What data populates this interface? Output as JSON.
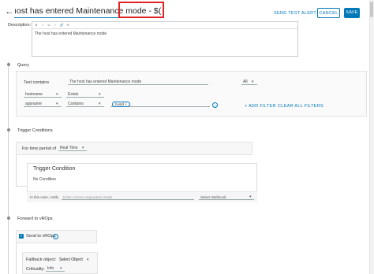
{
  "header": {
    "title_value": "ıost has entered Maintenance mode - $(Event ID)",
    "send_test_alert": "SEND TEST ALERT",
    "cancel": "CANCEL",
    "save": "SAVE"
  },
  "description": {
    "label": "Description:",
    "text": "The host has entered Maintenance mode",
    "toolbar": [
      "B",
      "I",
      "U",
      "𝑖",
      "🔗",
      "⟲"
    ]
  },
  "query": {
    "title": "Query",
    "text_contains_label": "Text contains",
    "text_contains_value": "The host has entered Maintenance mode",
    "all_select": "All",
    "rows": [
      {
        "field": "hostname",
        "operator": "Exists",
        "chip": ""
      },
      {
        "field": "appname",
        "operator": "Contains",
        "chip": "hostd"
      }
    ],
    "add_filter": "+ ADD FILTER",
    "clear_filters": "CLEAR ALL FILTERS"
  },
  "trigger": {
    "title": "Trigger Conditions",
    "period_label": "For time period of",
    "period_value": "Real Time",
    "card_title": "Trigger Condition",
    "card_subtitle": "No Condition",
    "notify_label": "In this case, notify",
    "notify_placeholder": "Enter comma separated emails",
    "webhook_select": "Select Webhook"
  },
  "forward": {
    "title": "Forward to vROps",
    "send_label": "Send to vROps",
    "fallback_label": "Fallback object:",
    "fallback_value": "Select Object",
    "criticality_label": "Criticality:",
    "criticality_value": "Info"
  },
  "colors": {
    "accent": "#0079b8",
    "highlight": "#e22323"
  }
}
